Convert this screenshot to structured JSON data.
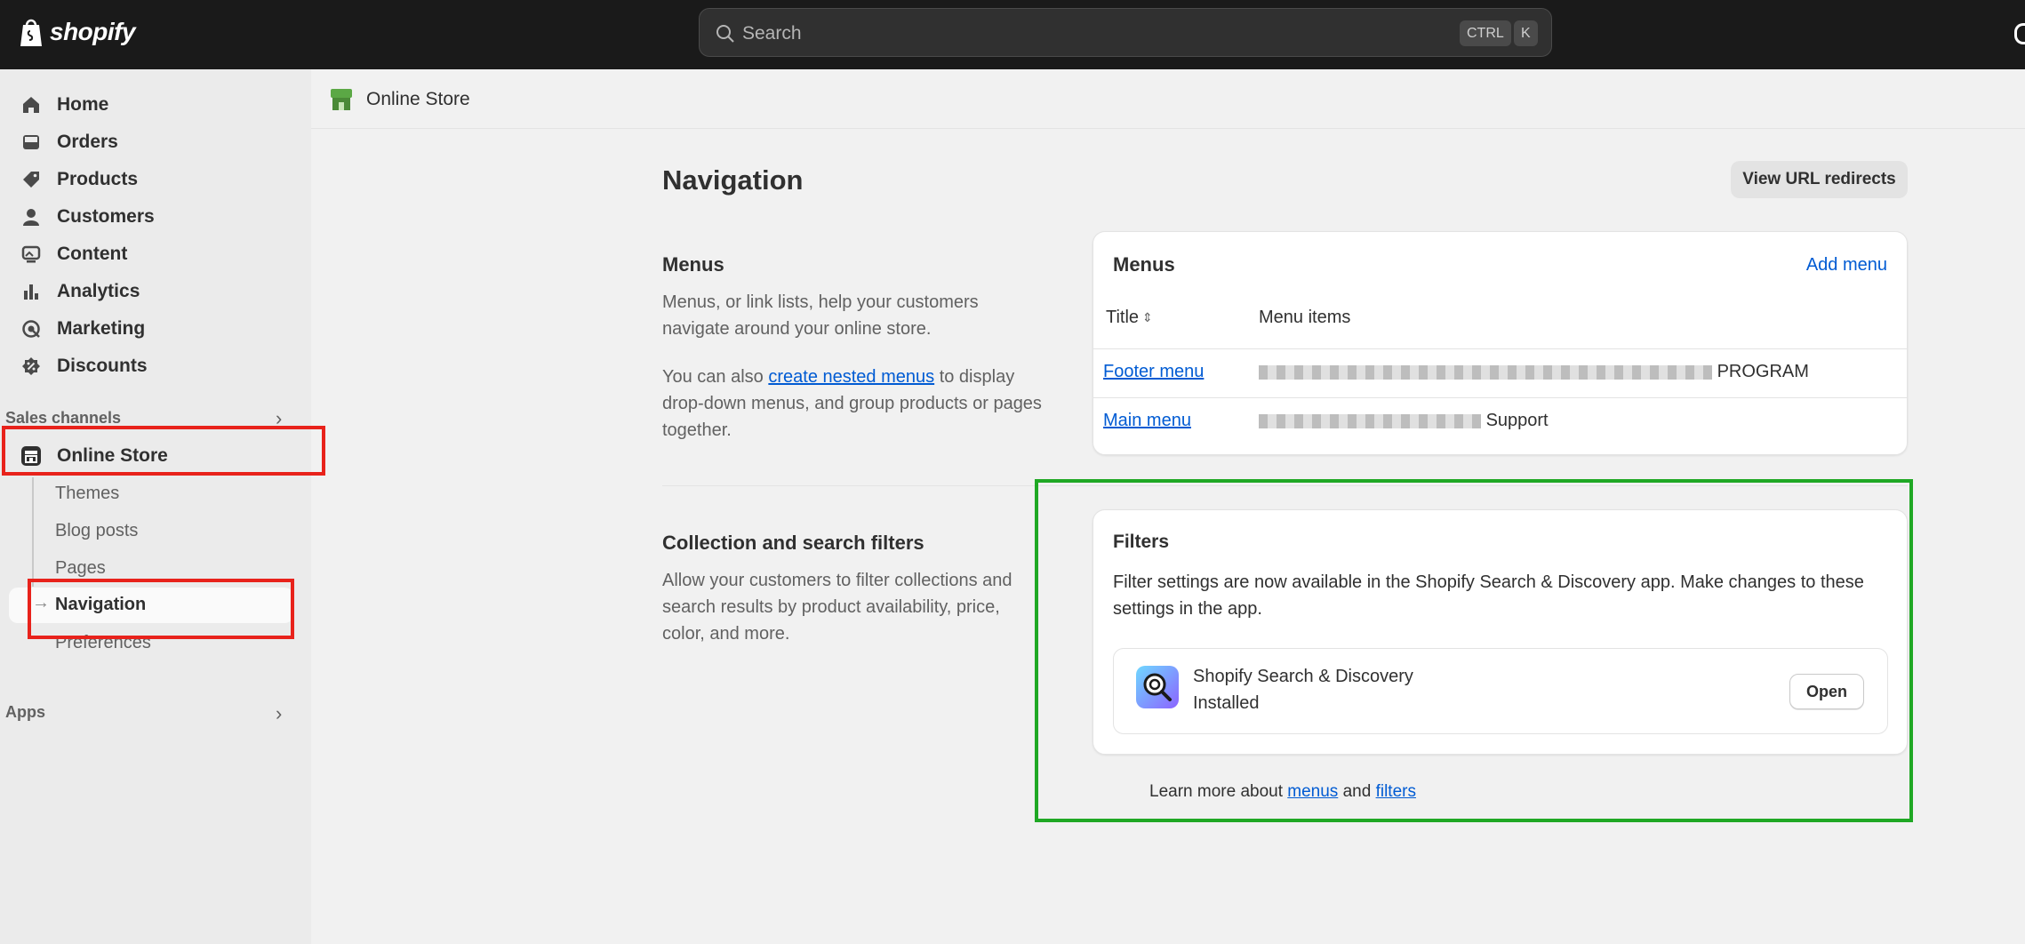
{
  "topbar": {
    "logo_text": "shopify",
    "search_placeholder": "Search",
    "shortcut_ctrl": "CTRL",
    "shortcut_k": "K"
  },
  "sidebar": {
    "items": [
      {
        "label": "Home",
        "icon": "home-icon"
      },
      {
        "label": "Orders",
        "icon": "inbox-icon"
      },
      {
        "label": "Products",
        "icon": "tag-icon"
      },
      {
        "label": "Customers",
        "icon": "person-icon"
      },
      {
        "label": "Content",
        "icon": "image-icon"
      },
      {
        "label": "Analytics",
        "icon": "bar-chart-icon"
      },
      {
        "label": "Marketing",
        "icon": "target-icon"
      },
      {
        "label": "Discounts",
        "icon": "discount-icon"
      }
    ],
    "sales_channels_label": "Sales channels",
    "online_store_label": "Online Store",
    "sub_items": [
      "Themes",
      "Blog posts",
      "Pages",
      "Navigation",
      "Preferences"
    ],
    "apps_label": "Apps"
  },
  "breadcrumb": {
    "label": "Online Store"
  },
  "page": {
    "title": "Navigation",
    "view_redirects_label": "View URL redirects"
  },
  "menus_section": {
    "title": "Menus",
    "desc1": "Menus, or link lists, help your customers navigate around your online store.",
    "desc2_before": "You can also ",
    "desc2_link": "create nested menus",
    "desc2_after": " to display drop-down menus, and group products or pages together.",
    "card_title": "Menus",
    "add_menu_label": "Add menu",
    "col_title": "Title",
    "col_items": "Menu items",
    "rows": [
      {
        "title": "Footer menu",
        "items_visible": "PROGRAM"
      },
      {
        "title": "Main menu",
        "items_visible": "Support"
      }
    ]
  },
  "filters_section": {
    "title": "Collection and search filters",
    "desc": "Allow your customers to filter collections and search results by product availability, price, color, and more.",
    "card_title": "Filters",
    "card_text": "Filter settings are now available in the Shopify Search & Discovery app. Make changes to these settings in the app.",
    "app_name": "Shopify Search & Discovery",
    "app_status": "Installed",
    "open_label": "Open"
  },
  "learn_more": {
    "prefix": "Learn more about ",
    "menus_link": "menus",
    "and": " and ",
    "filters_link": "filters"
  },
  "annotations": {
    "red_highlight_color": "#e8221b",
    "green_highlight_color": "#1fa824"
  }
}
